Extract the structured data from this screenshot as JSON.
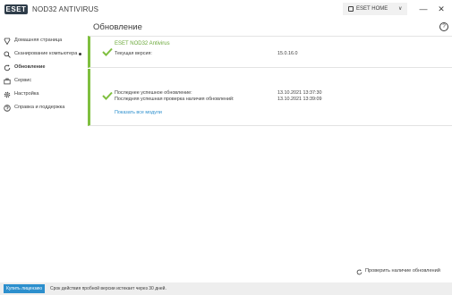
{
  "app": {
    "logo_text": "ESET",
    "product_name": "NOD32 ANTIVIRUS",
    "home_button": "ESET HOME",
    "minimize_glyph": "—",
    "close_glyph": "✕"
  },
  "sidebar": {
    "items": [
      {
        "label": "Домашняя страница",
        "icon": "shield-icon"
      },
      {
        "label": "Сканирование компьютера",
        "icon": "search-icon"
      },
      {
        "label": "Обновление",
        "icon": "refresh-icon"
      },
      {
        "label": "Сервис",
        "icon": "briefcase-icon"
      },
      {
        "label": "Настройка",
        "icon": "gear-icon"
      },
      {
        "label": "Справка и поддержка",
        "icon": "help-icon"
      }
    ],
    "active_index": 2
  },
  "main": {
    "title": "Обновление",
    "help_glyph": "?",
    "card1": {
      "title": "ESET NOD32 Antivirus",
      "version_label": "Текущая версия:",
      "version_value": "15.0.16.0"
    },
    "card2": {
      "last_update_label": "Последнее успешное обновление:",
      "last_update_value": "13.10.2021 13:37:30",
      "last_check_label": "Последняя успешная проверка наличия обновлений:",
      "last_check_value": "13.10.2021 13:39:09",
      "show_modules_link": "Показать все модули"
    },
    "check_updates_label": "Проверить наличие обновлений"
  },
  "footer": {
    "buy_button": "Купить лицензию",
    "trial_text": "Срок действия пробной версии истекает через 30 дней."
  },
  "colors": {
    "accent_green": "#7fbf3f",
    "link_blue": "#2c8fcd",
    "logo_dark": "#2f3d4a"
  }
}
